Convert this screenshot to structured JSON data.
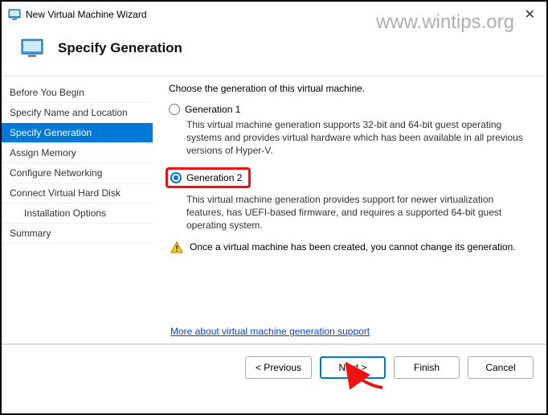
{
  "window": {
    "title": "New Virtual Machine Wizard"
  },
  "watermark": "www.wintips.org",
  "header": {
    "title": "Specify Generation"
  },
  "sidebar": {
    "items": [
      {
        "label": "Before You Begin"
      },
      {
        "label": "Specify Name and Location"
      },
      {
        "label": "Specify Generation"
      },
      {
        "label": "Assign Memory"
      },
      {
        "label": "Configure Networking"
      },
      {
        "label": "Connect Virtual Hard Disk"
      },
      {
        "label": "Installation Options"
      },
      {
        "label": "Summary"
      }
    ]
  },
  "content": {
    "instruction": "Choose the generation of this virtual machine.",
    "gen1_label": "Generation 1",
    "gen1_desc": "This virtual machine generation supports 32-bit and 64-bit guest operating systems and provides virtual hardware which has been available in all previous versions of Hyper-V.",
    "gen2_label": "Generation 2",
    "gen2_desc": "This virtual machine generation provides support for newer virtualization features, has UEFI-based firmware, and requires a supported 64-bit guest operating system.",
    "warning": "Once a virtual machine has been created, you cannot change its generation.",
    "link": "More about virtual machine generation support"
  },
  "footer": {
    "previous": "< Previous",
    "next": "Next >",
    "finish": "Finish",
    "cancel": "Cancel"
  }
}
